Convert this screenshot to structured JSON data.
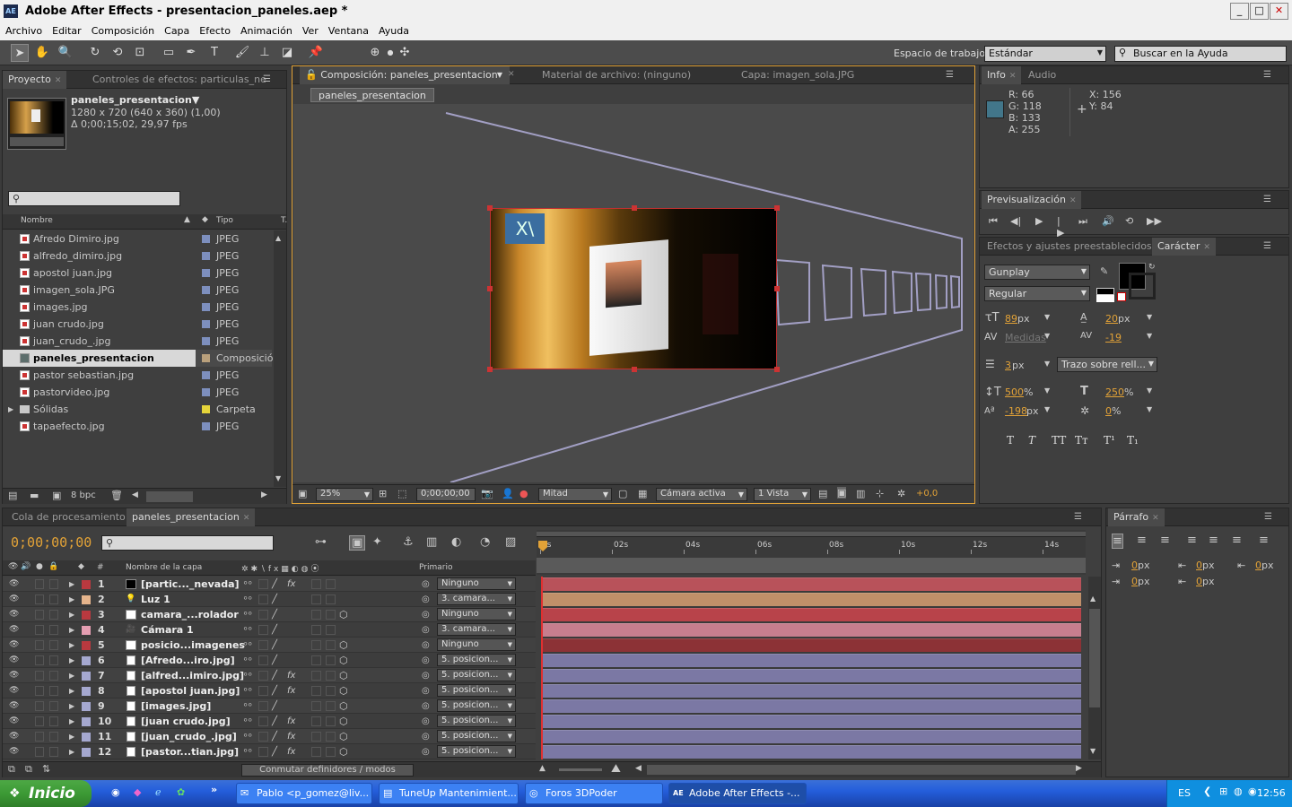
{
  "window": {
    "title": "Adobe After Effects - presentacion_paneles.aep *",
    "app_icon": "AE",
    "minimize": "_",
    "maximize": "□",
    "close": "✕"
  },
  "menu": [
    "Archivo",
    "Editar",
    "Composición",
    "Capa",
    "Efecto",
    "Animación",
    "Ver",
    "Ventana",
    "Ayuda"
  ],
  "toolbar": {
    "workspace_label": "Espacio de trabajo:",
    "workspace_value": "Estándar",
    "help_search": "Buscar en la Ayuda"
  },
  "project": {
    "tab_project": "Proyecto",
    "tab_effects": "Controles de efectos: particulas_nev.",
    "comp_name": "paneles_presentacion▼",
    "comp_size": "1280 x 720  (640 x 360) (1,00)",
    "comp_duration": "Δ 0;00;15;02, 29,97 fps",
    "col_name": "Nombre",
    "col_type": "Tipo",
    "col_extra": "T.",
    "bpc": "8 bpc",
    "items": [
      {
        "name": "Afredo Dimiro.jpg",
        "type": "JPEG",
        "color": "#7d8fbe",
        "kind": "file"
      },
      {
        "name": "alfredo_dimiro.jpg",
        "type": "JPEG",
        "color": "#7d8fbe",
        "kind": "file"
      },
      {
        "name": "apostol juan.jpg",
        "type": "JPEG",
        "color": "#7d8fbe",
        "kind": "file"
      },
      {
        "name": "imagen_sola.JPG",
        "type": "JPEG",
        "color": "#7d8fbe",
        "kind": "file"
      },
      {
        "name": "images.jpg",
        "type": "JPEG",
        "color": "#7d8fbe",
        "kind": "file"
      },
      {
        "name": "juan crudo.jpg",
        "type": "JPEG",
        "color": "#7d8fbe",
        "kind": "file"
      },
      {
        "name": "juan_crudo_.jpg",
        "type": "JPEG",
        "color": "#7d8fbe",
        "kind": "file"
      },
      {
        "name": "paneles_presentacion",
        "type": "Composición",
        "color": "#b9a07c",
        "kind": "comp",
        "selected": true
      },
      {
        "name": "pastor sebastian.jpg",
        "type": "JPEG",
        "color": "#7d8fbe",
        "kind": "file"
      },
      {
        "name": "pastorvideo.jpg",
        "type": "JPEG",
        "color": "#7d8fbe",
        "kind": "file"
      },
      {
        "name": "Sólidas",
        "type": "Carpeta",
        "color": "#e5d43a",
        "kind": "folder"
      },
      {
        "name": "tapaefecto.jpg",
        "type": "JPEG",
        "color": "#7d8fbe",
        "kind": "file"
      }
    ]
  },
  "composition": {
    "tab_comp": "Composición: paneles_presentacion",
    "tab_footage": "Material de archivo: (ninguno)",
    "tab_layer": "Capa: imagen_sola.JPG",
    "breadcrumb": "paneles_presentacion",
    "zoom": "25%",
    "timecode": "0;00;00;00",
    "resolution": "Mitad",
    "camera": "Cámara activa",
    "views": "1 Vista",
    "exposure": "+0,0"
  },
  "info": {
    "tab_info": "Info",
    "tab_audio": "Audio",
    "r": "R:  66",
    "g": "G:  118",
    "b": "B:  133",
    "a": "A:  255",
    "x": "X:  156",
    "y": "Y:  84",
    "swatch": "#42768a"
  },
  "preview": {
    "tab": "Previsualización"
  },
  "character": {
    "tab_effects": "Efectos y ajustes preestablecidos",
    "tab_char": "Carácter",
    "font": "Gunplay",
    "style": "Regular",
    "size": "89",
    "size_unit": "px",
    "leading": "20",
    "leading_unit": "px",
    "kerning": "Medidas",
    "tracking": "-19",
    "stroke": "3",
    "stroke_unit": "px",
    "stroke_mode": "Trazo sobre rell...",
    "vscale": "500",
    "hscale": "250",
    "pct": "%",
    "baseline": "-198",
    "baseline_unit": "px",
    "tsume": "0",
    "format_buttons": [
      "T",
      "T",
      "TT",
      "Tт",
      "T¹",
      "T₁"
    ]
  },
  "timeline": {
    "tab_render": "Cola de procesamiento",
    "tab_comp": "paneles_presentacion",
    "timecode": "0;00;00;00",
    "col_num": "#",
    "col_name": "Nombre de la capa",
    "col_parent": "Primario",
    "switch_label": "Conmutar definidores / modos",
    "ruler": [
      "0s",
      "02s",
      "04s",
      "06s",
      "08s",
      "10s",
      "12s",
      "14s"
    ],
    "layers": [
      {
        "num": "1",
        "name": "[partic..._nevada]",
        "label": "#b9393f",
        "swatch": "#000000",
        "parent": "Ninguno",
        "bar": "#b8525a",
        "fx": true
      },
      {
        "num": "2",
        "name": "Luz 1",
        "label": "#e5b48c",
        "swatch": "light",
        "parent": "3. camara...",
        "bar": "#c08f69",
        "fx": false
      },
      {
        "num": "3",
        "name": "camara_...rolador",
        "label": "#b9393f",
        "swatch": "#ffffff",
        "parent": "Ninguno",
        "bar": "#b8434a",
        "fx": false
      },
      {
        "num": "4",
        "name": "Cámara 1",
        "label": "#e59eb2",
        "swatch": "camera",
        "parent": "3. camara...",
        "bar": "#c77e8e",
        "fx": false
      },
      {
        "num": "5",
        "name": "posicio...imagenes",
        "label": "#b9393f",
        "swatch": "#ffffff",
        "parent": "Ninguno",
        "bar": "#8c3236",
        "fx": false
      },
      {
        "num": "6",
        "name": "[Afredo...iro.jpg]",
        "label": "#a5a8d0",
        "swatch": "file",
        "parent": "5. posicion...",
        "bar": "#7b78a4",
        "fx": false
      },
      {
        "num": "7",
        "name": "[alfred...imiro.jpg]",
        "label": "#a5a8d0",
        "swatch": "file",
        "parent": "5. posicion...",
        "bar": "#7b78a4",
        "fx": true
      },
      {
        "num": "8",
        "name": "[apostol juan.jpg]",
        "label": "#a5a8d0",
        "swatch": "file",
        "parent": "5. posicion...",
        "bar": "#7b78a4",
        "fx": true
      },
      {
        "num": "9",
        "name": "[images.jpg]",
        "label": "#a5a8d0",
        "swatch": "file",
        "parent": "5. posicion...",
        "bar": "#7b78a4",
        "fx": false
      },
      {
        "num": "10",
        "name": "[juan crudo.jpg]",
        "label": "#a5a8d0",
        "swatch": "file",
        "parent": "5. posicion...",
        "bar": "#7b78a4",
        "fx": true
      },
      {
        "num": "11",
        "name": "[juan_crudo_.jpg]",
        "label": "#a5a8d0",
        "swatch": "file",
        "parent": "5. posicion...",
        "bar": "#7b78a4",
        "fx": true
      },
      {
        "num": "12",
        "name": "[pastor...tian.jpg]",
        "label": "#a5a8d0",
        "swatch": "file",
        "parent": "5. posicion...",
        "bar": "#7b78a4",
        "fx": true
      }
    ]
  },
  "paragraph": {
    "tab": "Párrafo",
    "v1": "0",
    "v2": "0",
    "v3": "0",
    "v4": "0",
    "v5": "0",
    "unit": "px"
  },
  "taskbar": {
    "start": "Inicio",
    "tasks": [
      {
        "label": "Pablo <p_gomez@liv...",
        "active": false
      },
      {
        "label": "TuneUp Mantenimient...",
        "active": false
      },
      {
        "label": "Foros 3DPoder",
        "active": false
      },
      {
        "label": "Adobe After Effects -...",
        "active": true
      }
    ],
    "lang": "ES",
    "clock": "12:56",
    "chevron": "»"
  },
  "colors": {
    "accent": "#e2a237",
    "panel": "#3f3f3f",
    "highlight": "#ffcc33"
  }
}
